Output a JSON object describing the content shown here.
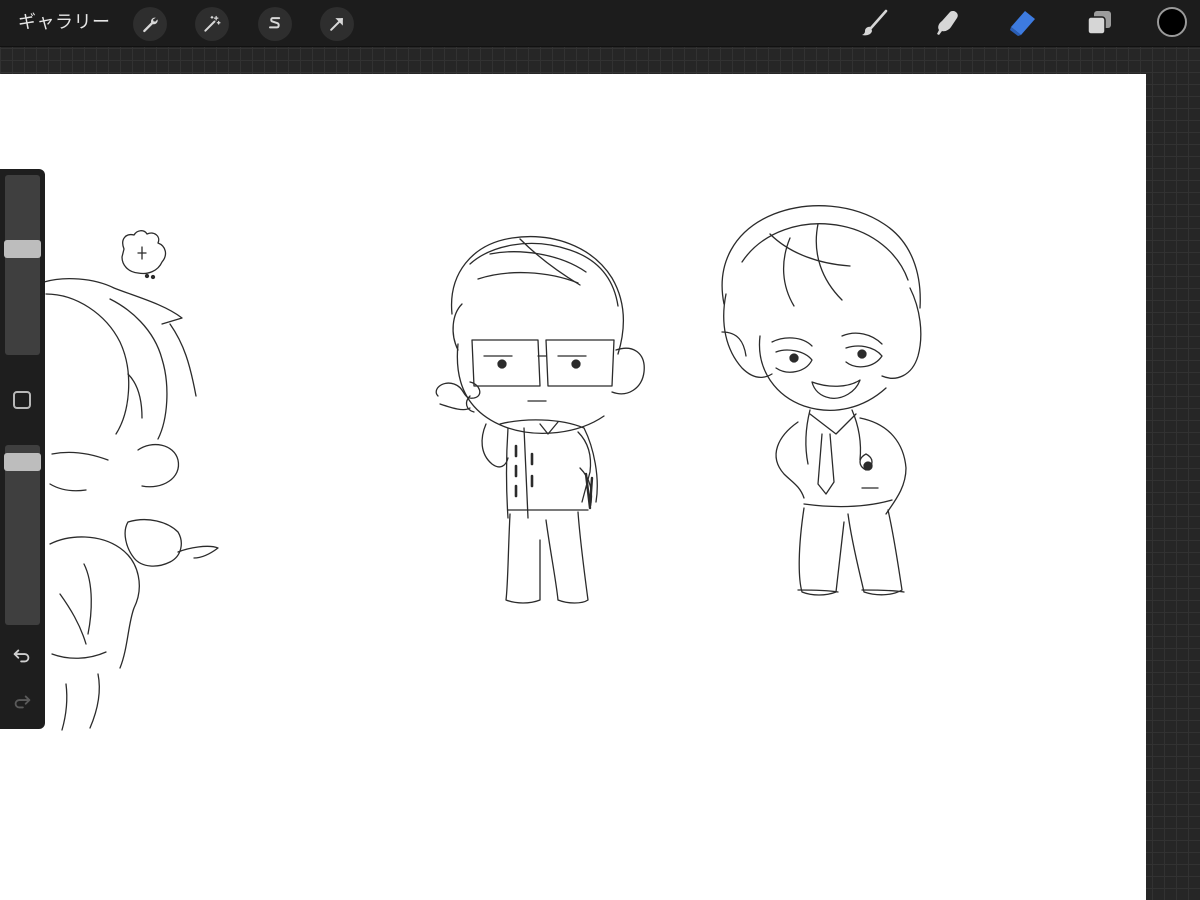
{
  "topbar": {
    "gallery_label": "ギャラリー",
    "left_tools": [
      {
        "name": "actions",
        "icon": "wrench-icon"
      },
      {
        "name": "adjustments",
        "icon": "magic-wand-icon"
      },
      {
        "name": "selection",
        "icon": "selection-s-icon"
      },
      {
        "name": "transform",
        "icon": "arrow-cursor-icon"
      }
    ],
    "right_tools": [
      {
        "name": "brush",
        "icon": "brush-icon",
        "active": false
      },
      {
        "name": "smudge",
        "icon": "smudge-icon",
        "active": false
      },
      {
        "name": "eraser",
        "icon": "eraser-icon",
        "active": true
      },
      {
        "name": "layers",
        "icon": "layers-icon",
        "active": false
      }
    ],
    "current_color": "#000000"
  },
  "sidebar": {
    "brush_size_level": 0.6,
    "opacity_level": 0.95,
    "undo_icon": "undo-icon",
    "redo_icon": "redo-icon",
    "modifier_icon": "modifier-square-icon"
  },
  "colors": {
    "accent_active": "#3d7be0",
    "toolbar_bg": "#1c1c1c",
    "canvas_bg": "#ffffff"
  }
}
